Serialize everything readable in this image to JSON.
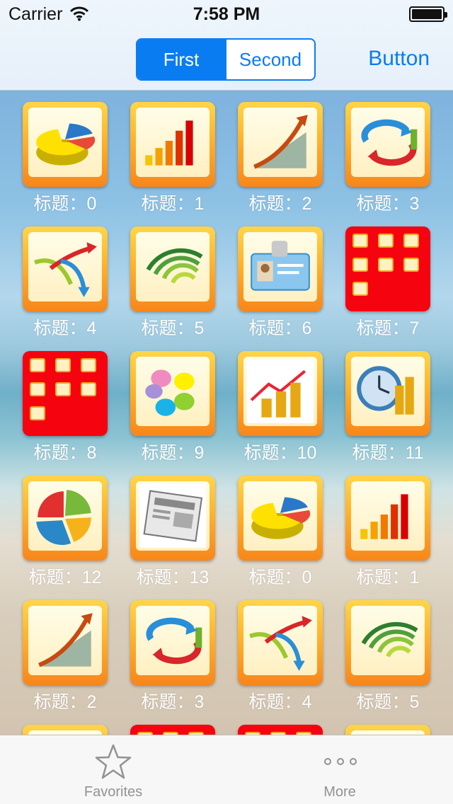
{
  "status": {
    "carrier": "Carrier",
    "time": "7:58 PM"
  },
  "nav": {
    "segments": [
      "First",
      "Second"
    ],
    "selected_index": 0,
    "button": "Button"
  },
  "grid": {
    "items": [
      {
        "label": "标题：0",
        "icon": "pie-chart-icon"
      },
      {
        "label": "标题：1",
        "icon": "bar-chart-icon"
      },
      {
        "label": "标题：2",
        "icon": "growth-chart-icon"
      },
      {
        "label": "标题：3",
        "icon": "cycle-arrows-icon"
      },
      {
        "label": "标题：4",
        "icon": "split-arrows-icon"
      },
      {
        "label": "标题：5",
        "icon": "signal-arcs-icon"
      },
      {
        "label": "标题：6",
        "icon": "id-badge-icon"
      },
      {
        "label": "标题：7",
        "icon": "folder-icon"
      },
      {
        "label": "标题：8",
        "icon": "folder-icon"
      },
      {
        "label": "标题：9",
        "icon": "petals-icon"
      },
      {
        "label": "标题：10",
        "icon": "coins-chart-icon"
      },
      {
        "label": "标题：11",
        "icon": "clock-coins-icon"
      },
      {
        "label": "标题：12",
        "icon": "pie-chart-color-icon"
      },
      {
        "label": "标题：13",
        "icon": "newspaper-icon"
      },
      {
        "label": "标题：0",
        "icon": "pie-chart-icon"
      },
      {
        "label": "标题：1",
        "icon": "bar-chart-icon"
      },
      {
        "label": "标题：2",
        "icon": "growth-chart-icon"
      },
      {
        "label": "标题：3",
        "icon": "cycle-arrows-icon"
      },
      {
        "label": "标题：4",
        "icon": "split-arrows-icon"
      },
      {
        "label": "标题：5",
        "icon": "signal-arcs-icon"
      },
      {
        "label": "",
        "icon": "app-icon"
      },
      {
        "label": "",
        "icon": "folder-icon"
      },
      {
        "label": "",
        "icon": "folder-icon"
      },
      {
        "label": "",
        "icon": "app-icon"
      }
    ],
    "newspaper_text": "NEWS"
  },
  "tabbar": {
    "items": [
      {
        "label": "Favorites",
        "icon": "star-icon"
      },
      {
        "label": "More",
        "icon": "more-dots-icon"
      }
    ]
  },
  "colors": {
    "tint": "#0a7cf2",
    "folder_red": "#f5030f",
    "icon_orange": "#f7861b"
  }
}
